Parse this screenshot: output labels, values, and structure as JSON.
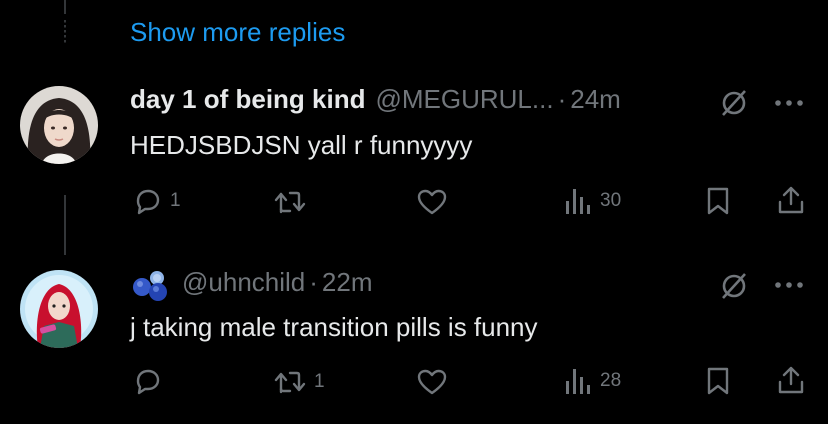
{
  "thread": {
    "show_more_label": "Show more replies"
  },
  "replies": [
    {
      "display_name": "day 1 of being kind",
      "handle": "@MEGURUL...",
      "separator": "·",
      "time": "24m",
      "text": "HEDJSBDJSN yall r funnyyyy",
      "reply_count": "1",
      "repost_count": "",
      "like_count": "",
      "view_count": "30",
      "icons": [
        "grok-icon",
        "more-icon",
        "reply-icon",
        "repost-icon",
        "like-icon",
        "views-icon",
        "bookmark-icon",
        "share-icon"
      ]
    },
    {
      "display_name": "",
      "handle": "@uhnchild",
      "separator": "·",
      "time": "22m",
      "text": "j taking male transition pills is funny",
      "reply_count": "",
      "repost_count": "1",
      "like_count": "",
      "view_count": "28",
      "icons": [
        "blue-balloons-icon",
        "grok-icon",
        "more-icon",
        "reply-icon",
        "repost-icon",
        "like-icon",
        "views-icon",
        "bookmark-icon",
        "share-icon"
      ]
    }
  ],
  "colors": {
    "background": "#000000",
    "text": "#e7e9ea",
    "muted": "#71767b",
    "accent": "#1d9bf0",
    "line": "#333639"
  }
}
